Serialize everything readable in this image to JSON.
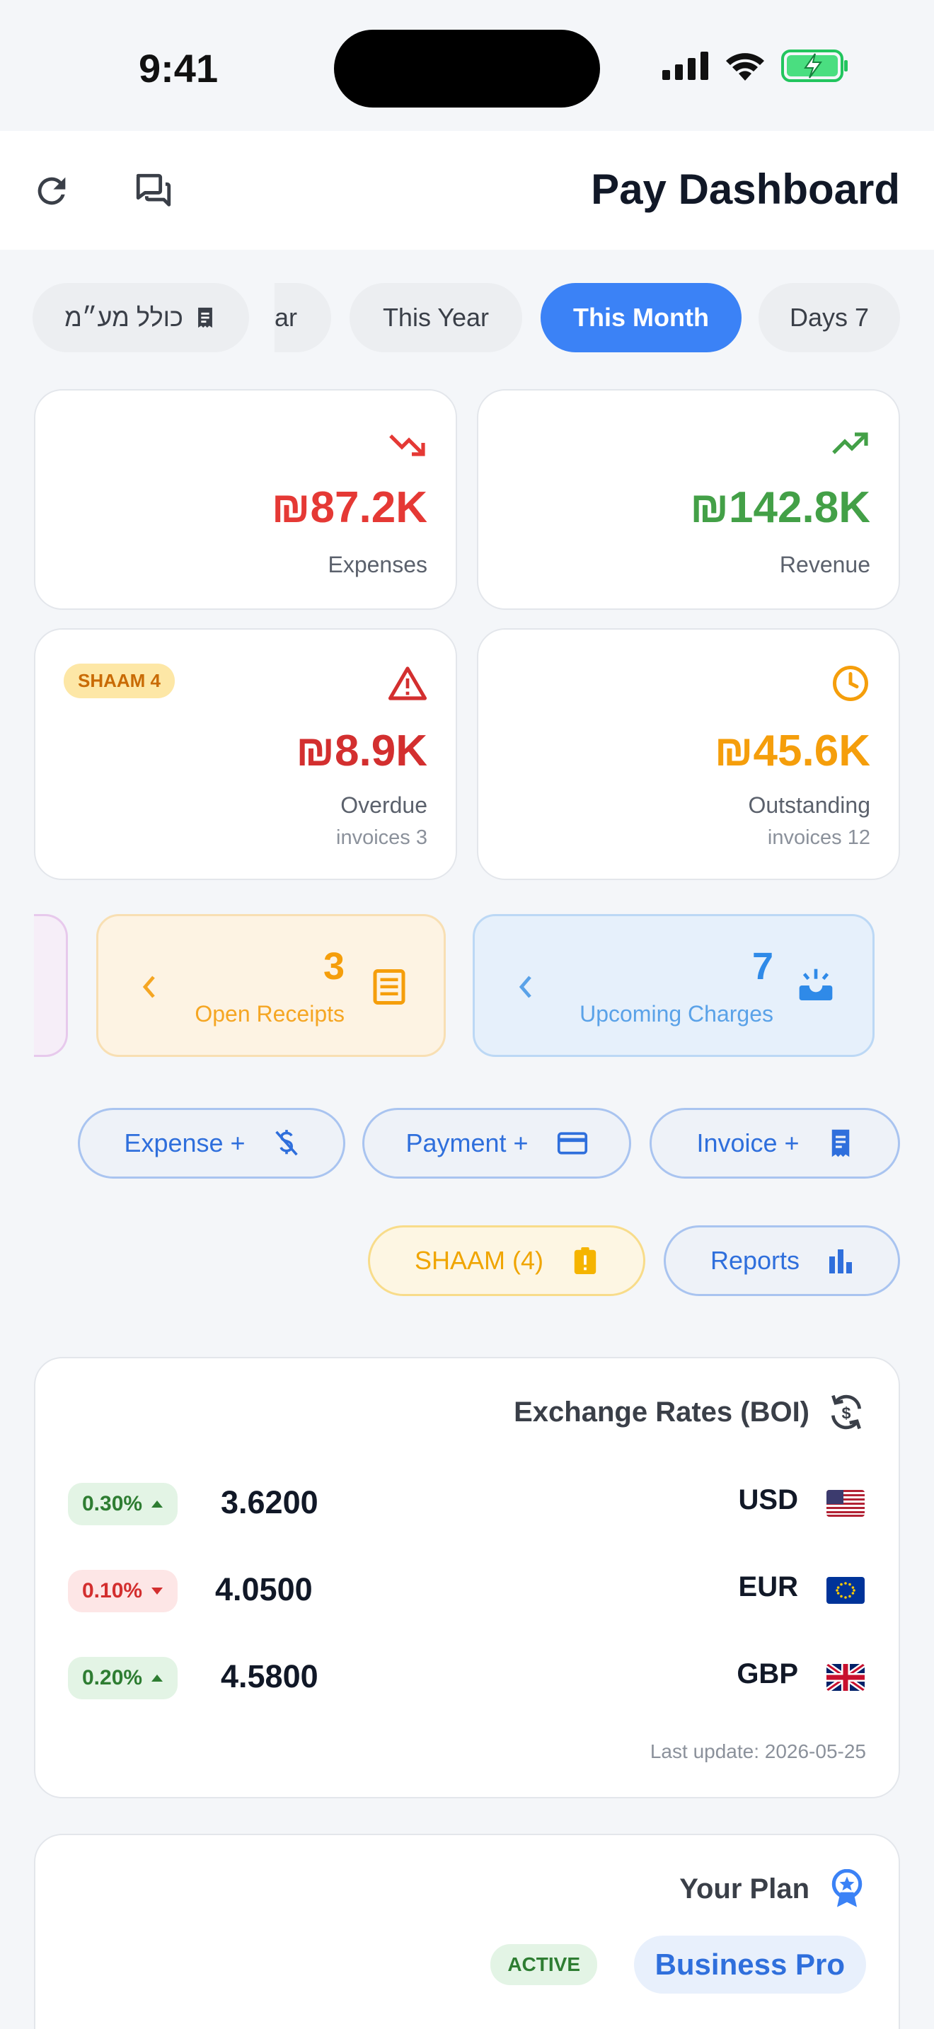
{
  "status": {
    "time": "9:41"
  },
  "header": {
    "title": "Pay Dashboard"
  },
  "periods": [
    {
      "label": "כולל מע״מ",
      "icon": "receipt-icon"
    },
    {
      "label": "ar"
    },
    {
      "label": "This Year"
    },
    {
      "label": "This Month",
      "active": true
    },
    {
      "label": "Days 7"
    }
  ],
  "stats": {
    "expenses": {
      "amount": "₪87.2K",
      "label": "Expenses",
      "color": "#e53935"
    },
    "revenue": {
      "amount": "₪142.8K",
      "label": "Revenue",
      "color": "#43a047"
    },
    "overdue": {
      "amount": "₪8.9K",
      "label": "Overdue",
      "sub": "invoices 3",
      "badge": "SHAAM 4",
      "color": "#d32f2f"
    },
    "outstanding": {
      "amount": "₪45.6K",
      "label": "Outstanding",
      "sub": "invoices 12",
      "color": "#f59e0b"
    }
  },
  "summary": {
    "receipts": {
      "count": "3",
      "label": "Open Receipts"
    },
    "charges": {
      "count": "7",
      "label": "Upcoming Charges"
    }
  },
  "actions": {
    "expense": "Expense +",
    "payment": "Payment +",
    "invoice": "Invoice +",
    "shaam": "SHAAM (4)",
    "reports": "Reports"
  },
  "exchange": {
    "title": "Exchange Rates (BOI)",
    "rows": [
      {
        "change": "0.30%",
        "dir": "up",
        "value": "3.6200",
        "currency": "USD"
      },
      {
        "change": "0.10%",
        "dir": "down",
        "value": "4.0500",
        "currency": "EUR"
      },
      {
        "change": "0.20%",
        "dir": "up",
        "value": "4.5800",
        "currency": "GBP"
      }
    ],
    "last_update": "Last update: 2026-05-25"
  },
  "plan": {
    "title": "Your Plan",
    "status": "ACTIVE",
    "name": "Business Pro"
  }
}
